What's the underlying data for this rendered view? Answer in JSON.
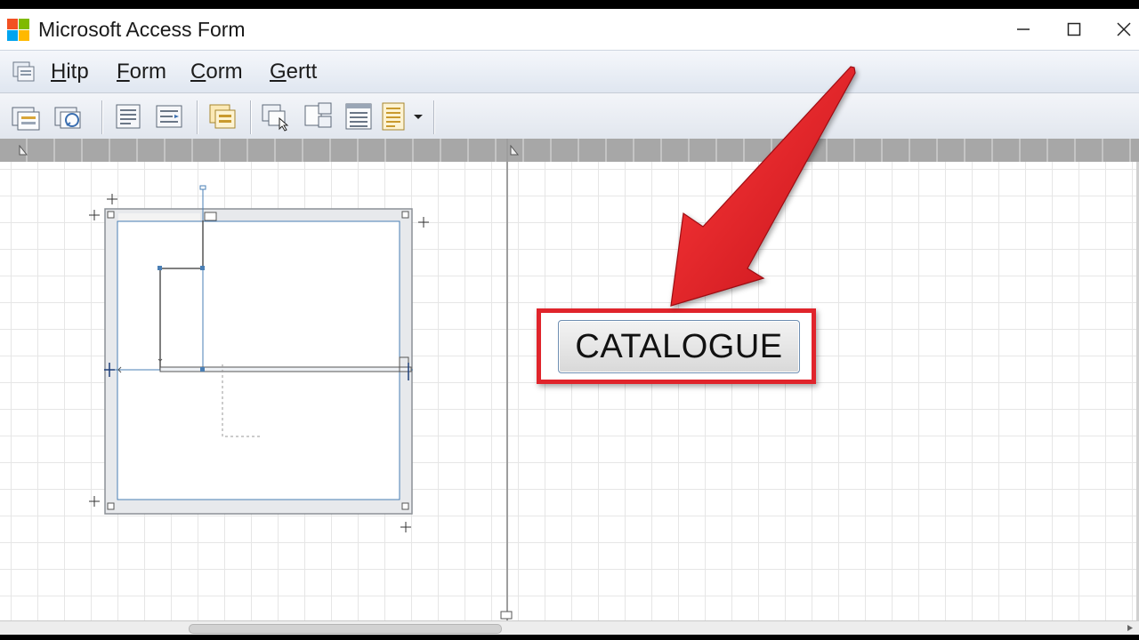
{
  "window": {
    "title": "Microsoft Access Form"
  },
  "menu": {
    "items": [
      {
        "label": "Hitp"
      },
      {
        "label": "Form"
      },
      {
        "label": "Corm"
      },
      {
        "label": "Gertt"
      }
    ]
  },
  "toolbar": {
    "icons": [
      "form-icon",
      "form-wizard-icon",
      "properties-icon",
      "tab-order-icon",
      "subform-icon",
      "control-icon",
      "group-icon",
      "list-icon",
      "report-icon",
      "dropdown-arrow-icon"
    ]
  },
  "canvas": {
    "catalogue_button_label": "CATALOGUE"
  },
  "colors": {
    "highlight_red": "#e0242b",
    "button_border": "#6f8fb2",
    "selection_blue": "#4a7fb5"
  }
}
